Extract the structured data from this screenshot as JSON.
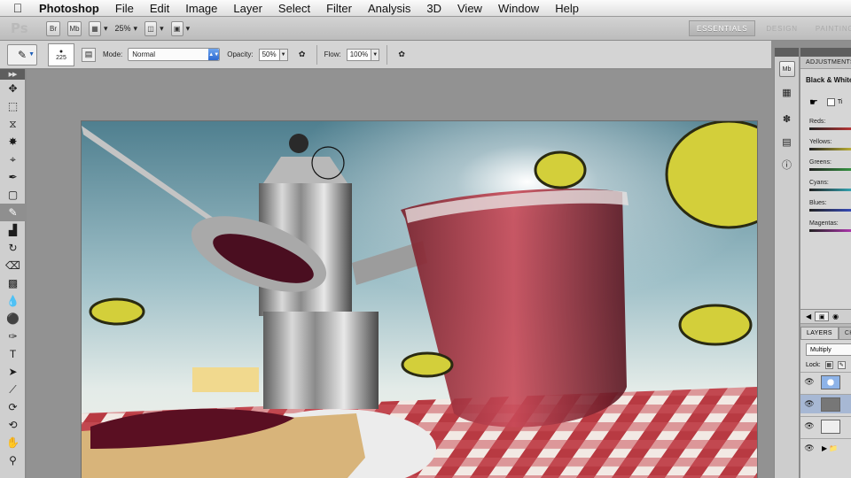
{
  "menubar": {
    "app_name": "Photoshop",
    "items": [
      "File",
      "Edit",
      "Image",
      "Layer",
      "Select",
      "Filter",
      "Analysis",
      "3D",
      "View",
      "Window",
      "Help"
    ]
  },
  "appbar": {
    "logo": "Ps",
    "btn_br": "Br",
    "btn_mb": "Mb",
    "zoom": "25%",
    "workspaces": [
      "ESSENTIALS",
      "DESIGN",
      "PAINTING"
    ]
  },
  "options": {
    "brush_size": "225",
    "mode_label": "Mode:",
    "mode_value": "Normal",
    "opacity_label": "Opacity:",
    "opacity_value": "50%",
    "flow_label": "Flow:",
    "flow_value": "100%"
  },
  "adjustments": {
    "tab_label": "ADJUSTMENTS",
    "preset": "Black & White",
    "tint_label": "Ti",
    "sliders": [
      {
        "label": "Reds:",
        "color": "#e03b3b"
      },
      {
        "label": "Yellows:",
        "color": "#e3d33a"
      },
      {
        "label": "Greens:",
        "color": "#3bb34a"
      },
      {
        "label": "Cyans:",
        "color": "#38c6d8"
      },
      {
        "label": "Blues:",
        "color": "#3b55e0"
      },
      {
        "label": "Magentas:",
        "color": "#d23bd2"
      }
    ]
  },
  "layers": {
    "tab_layers": "LAYERS",
    "tab_channels": "CH",
    "blend_mode": "Multiply",
    "lock_label": "Lock:"
  },
  "colors": {
    "accent_blue": "#2d69d0",
    "panel_bg": "#d6d6d6",
    "canvas_bg": "#929292"
  }
}
